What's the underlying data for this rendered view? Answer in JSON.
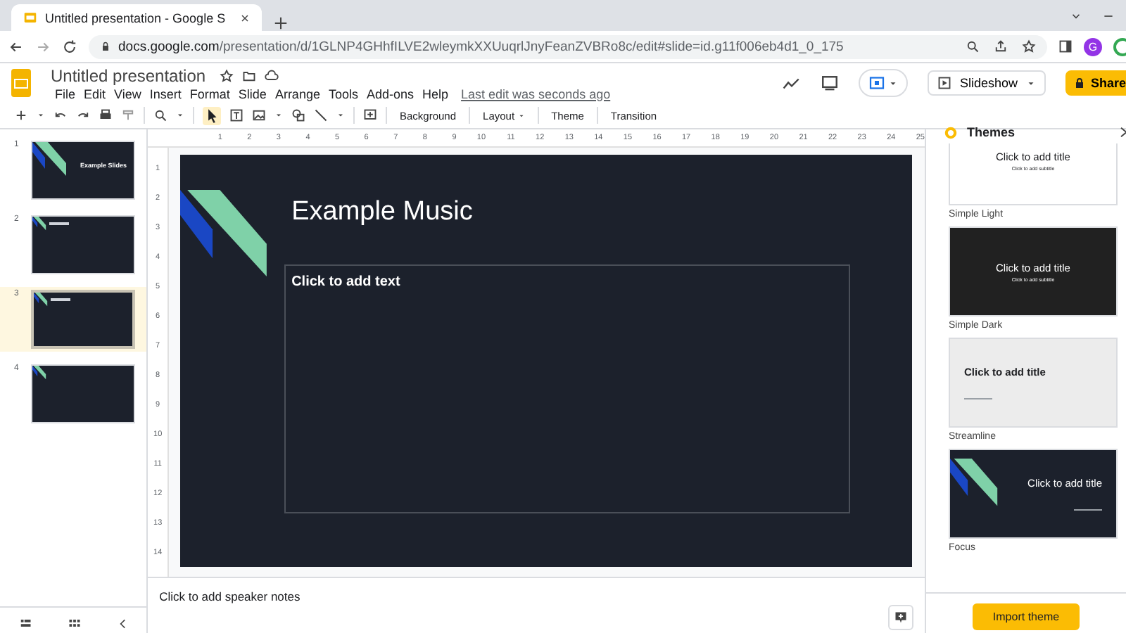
{
  "browser": {
    "tab_title": "Untitled presentation - Google S",
    "url_host": "docs.google.com",
    "url_path": "/presentation/d/1GLNP4GHhfILVE2wleymkXXUuqrlJnyFeanZVBRo8c/edit#slide=id.g11f006eb4d1_0_175",
    "profile_initial": "G"
  },
  "document": {
    "title": "Untitled presentation",
    "last_edit": "Last edit was seconds ago"
  },
  "menu": [
    "File",
    "Edit",
    "View",
    "Insert",
    "Format",
    "Slide",
    "Arrange",
    "Tools",
    "Add-ons",
    "Help"
  ],
  "header_buttons": {
    "slideshow": "Slideshow",
    "share": "Share"
  },
  "toolbar_buttons": [
    {
      "label": "Background",
      "kind": "plain"
    },
    {
      "label": "Layout",
      "kind": "dropdown"
    },
    {
      "label": "Theme",
      "kind": "plain"
    },
    {
      "label": "Transition",
      "kind": "plain"
    }
  ],
  "ruler": {
    "horizontal": [
      "1",
      "2",
      "3",
      "4",
      "5",
      "6",
      "7",
      "8",
      "9",
      "10",
      "11",
      "12",
      "13",
      "14",
      "15",
      "16",
      "17",
      "18",
      "19",
      "20",
      "21",
      "22",
      "23",
      "24",
      "25"
    ],
    "vertical": [
      "1",
      "2",
      "3",
      "4",
      "5",
      "6",
      "7",
      "8",
      "9",
      "10",
      "11",
      "12",
      "13",
      "14"
    ]
  },
  "slides": [
    {
      "number": "1",
      "selected": false,
      "kind": "title",
      "title": "Example Slides"
    },
    {
      "number": "2",
      "selected": false,
      "kind": "heading"
    },
    {
      "number": "3",
      "selected": true,
      "kind": "heading"
    },
    {
      "number": "4",
      "selected": false,
      "kind": "blank"
    }
  ],
  "current_slide": {
    "title": "Example Music",
    "body_placeholder": "Click to add text"
  },
  "speaker_notes": {
    "placeholder": "Click to add speaker notes"
  },
  "themes_panel": {
    "title": "Themes",
    "import_button": "Import theme",
    "themes": [
      {
        "name": "Simple Light",
        "kind": "light",
        "title": "Click to add title",
        "subtitle": "Click to add subtitle"
      },
      {
        "name": "Simple Dark",
        "kind": "dark",
        "title": "Click to add title",
        "subtitle": "Click to add subtitle"
      },
      {
        "name": "Streamline",
        "kind": "streamline",
        "title": "Click to add title"
      },
      {
        "name": "Focus",
        "kind": "focus",
        "title": "Click to add title"
      }
    ]
  }
}
